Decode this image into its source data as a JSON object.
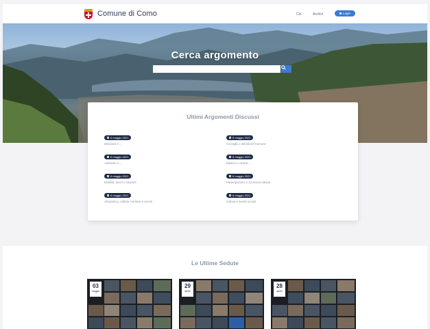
{
  "header": {
    "brand_name": "Comune di Como",
    "nav": [
      "Chi",
      "Archivi"
    ],
    "login_label": "Login"
  },
  "hero": {
    "title": "Cerca argomento",
    "search_placeholder": ""
  },
  "topics": {
    "title": "Ultimi Argomenti Discussi",
    "items": [
      {
        "date": "6 maggio 2021",
        "text": "Istituzioni e ..."
      },
      {
        "date": "6 maggio 2021",
        "text": "Consiglio e attività del Comune"
      },
      {
        "date": "6 maggio 2021",
        "text": "Ambiente e ..."
      },
      {
        "date": "6 maggio 2021",
        "text": "Bilancio e risorse ..."
      },
      {
        "date": "6 maggio 2021",
        "text": "Mobilità, lavori e trasporti"
      },
      {
        "date": "6 maggio 2021",
        "text": "Partecipazione e sicurezza urbana"
      },
      {
        "date": "6 maggio 2021",
        "text": "Urbanistica, edilizia, territorio e servizi"
      },
      {
        "date": "6 maggio 2021",
        "text": "Cultura e servizi sociali"
      }
    ]
  },
  "sessions": {
    "title": "Le Ultime Sedute",
    "items": [
      {
        "day": "03",
        "month": "maggio"
      },
      {
        "day": "29",
        "month": "aprile"
      },
      {
        "day": "28",
        "month": "aprile"
      }
    ]
  },
  "colors": {
    "accent": "#3a7bd5",
    "badge": "#1f2a44",
    "brand_red": "#c8102e"
  }
}
